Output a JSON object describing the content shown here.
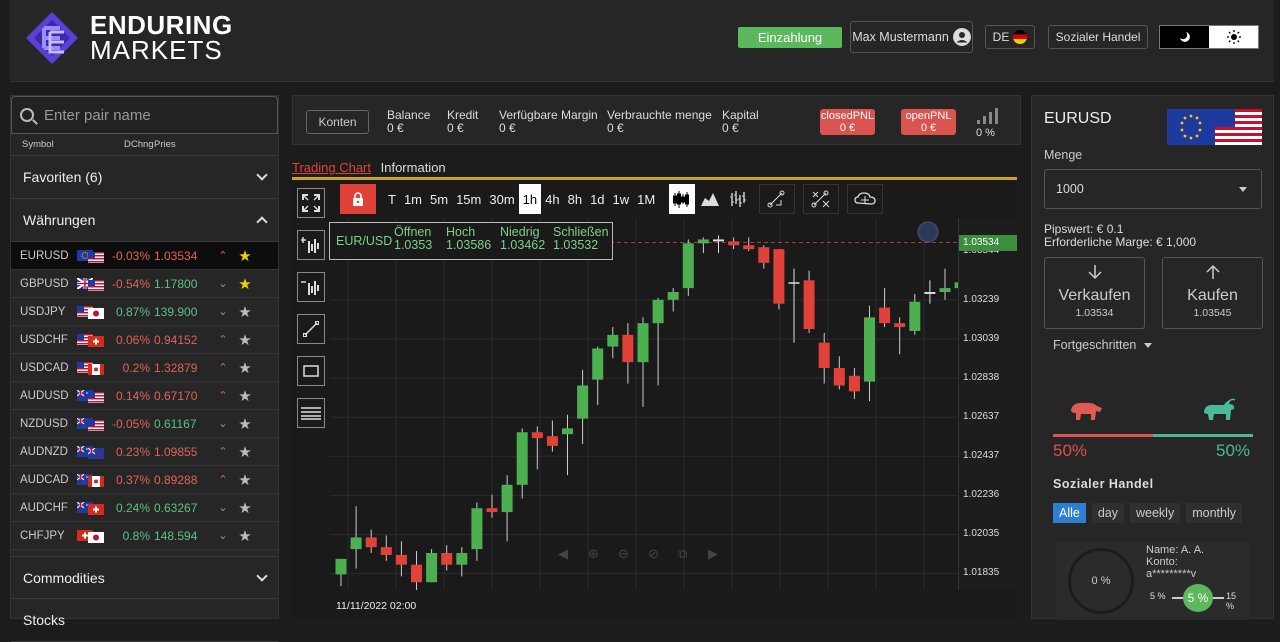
{
  "logo": {
    "line1": "ENDURING",
    "line2": "MARKETS"
  },
  "header": {
    "deposit_label": "Einzahlung",
    "user_name": "Max Mustermann",
    "language": "DE",
    "social_label": "Sozialer Handel",
    "theme_dark_icon": "moon-icon",
    "theme_light_icon": "sun-icon"
  },
  "watchlist": {
    "search_placeholder": "Enter pair name",
    "col_symbol": "Symbol",
    "col_change": "DChng",
    "col_price": "Pries",
    "favorites_label": "Favoriten (6)",
    "currencies_label": "Währungen",
    "commodities_label": "Commodities",
    "stocks_label": "Stocks",
    "pairs": [
      {
        "symbol": "EURUSD",
        "change": "-0.03%",
        "price": "1.03534",
        "dir": "up",
        "fav": true
      },
      {
        "symbol": "GBPUSD",
        "change": "-0.54%",
        "price": "1.17800",
        "dir": "down",
        "fav": true
      },
      {
        "symbol": "USDJPY",
        "change": "0.87%",
        "price": "139.900",
        "dir": "down",
        "fav": false
      },
      {
        "symbol": "USDCHF",
        "change": "0.06%",
        "price": "0.94152",
        "dir": "up",
        "fav": false
      },
      {
        "symbol": "USDCAD",
        "change": "0.2%",
        "price": "1.32879",
        "dir": "up",
        "fav": false
      },
      {
        "symbol": "AUDUSD",
        "change": "0.14%",
        "price": "0.67170",
        "dir": "up",
        "fav": false
      },
      {
        "symbol": "NZDUSD",
        "change": "-0.05%",
        "price": "0.61167",
        "dir": "down",
        "fav": false
      },
      {
        "symbol": "AUDNZD",
        "change": "0.23%",
        "price": "1.09855",
        "dir": "up",
        "fav": false
      },
      {
        "symbol": "AUDCAD",
        "change": "0.37%",
        "price": "0.89288",
        "dir": "up",
        "fav": false
      },
      {
        "symbol": "AUDCHF",
        "change": "0.24%",
        "price": "0.63267",
        "dir": "down",
        "fav": false
      },
      {
        "symbol": "CHFJPY",
        "change": "0.8%",
        "price": "148.594",
        "dir": "down",
        "fav": false
      }
    ]
  },
  "account": {
    "konten_label": "Konten",
    "balance_label": "Balance",
    "balance_value": "0 €",
    "kredit_label": "Kredit",
    "kredit_value": "0 €",
    "margin_label": "Verfügbare Margin",
    "margin_value": "0 €",
    "used_label": "Verbrauchte menge",
    "used_value": "0 €",
    "kapital_label": "Kapital",
    "kapital_value": "0 €",
    "closed_label": "closedPNL",
    "closed_value": "0 €",
    "open_label": "openPNL",
    "open_value": "0 €",
    "signal_pct": "0 %"
  },
  "chart_tabs": {
    "chart": "Trading Chart",
    "info": "Information"
  },
  "timeframes": [
    "T",
    "1m",
    "5m",
    "15m",
    "30m",
    "1h",
    "4h",
    "8h",
    "1d",
    "1w",
    "1M"
  ],
  "active_timeframe": "1h",
  "chart_legend": {
    "pair": "EUR/USD",
    "open_label": "Öffnen",
    "open": "1.0353",
    "high_label": "Hoch",
    "high": "1.03586",
    "low_label": "Niedrig",
    "low": "1.03462",
    "close_label": "Schließen",
    "close": "1.03532"
  },
  "chart_data": {
    "type": "candlestick",
    "y_ticks": [
      "1.03239",
      "1.03039",
      "1.02838",
      "1.02637",
      "1.02437",
      "1.02236",
      "1.02035",
      "1.01835"
    ],
    "current_price": "1.03534",
    "partial_tick": "1.03544",
    "x_label": "11/11/2022 02:00",
    "ylim": [
      1.0175,
      1.0366
    ],
    "colors": {
      "up": "#4caf50",
      "down": "#e0423a"
    },
    "candles": [
      [
        1.0183,
        1.0191,
        1.0177,
        1.0191
      ],
      [
        1.0196,
        1.0218,
        1.0186,
        1.0202
      ],
      [
        1.0202,
        1.0206,
        1.0194,
        1.0197
      ],
      [
        1.0197,
        1.0203,
        1.019,
        1.0193
      ],
      [
        1.0193,
        1.02,
        1.0182,
        1.0188
      ],
      [
        1.0188,
        1.0195,
        1.0172,
        1.0179
      ],
      [
        1.0179,
        1.0196,
        1.0179,
        1.0194
      ],
      [
        1.0194,
        1.0198,
        1.0185,
        1.0188
      ],
      [
        1.0188,
        1.0197,
        1.0182,
        1.0194
      ],
      [
        1.0196,
        1.022,
        1.019,
        1.0217
      ],
      [
        1.0217,
        1.0224,
        1.0212,
        1.0215
      ],
      [
        1.0215,
        1.0234,
        1.02,
        1.0229
      ],
      [
        1.0229,
        1.0258,
        1.0222,
        1.0256
      ],
      [
        1.0256,
        1.0259,
        1.0237,
        1.0253
      ],
      [
        1.0254,
        1.0262,
        1.0246,
        1.0249
      ],
      [
        1.0255,
        1.0265,
        1.0234,
        1.0258
      ],
      [
        1.0263,
        1.0288,
        1.025,
        1.028
      ],
      [
        1.0283,
        1.03,
        1.027,
        1.0299
      ],
      [
        1.03,
        1.031,
        1.0294,
        1.0306
      ],
      [
        1.0306,
        1.0312,
        1.0281,
        1.0292
      ],
      [
        1.0292,
        1.0315,
        1.0269,
        1.0312
      ],
      [
        1.0312,
        1.0325,
        1.028,
        1.0324
      ],
      [
        1.0324,
        1.033,
        1.0318,
        1.0328
      ],
      [
        1.033,
        1.0355,
        1.0326,
        1.0353
      ],
      [
        1.0353,
        1.0356,
        1.0348,
        1.0355
      ],
      [
        1.0355,
        1.0357,
        1.0348,
        1.0354
      ],
      [
        1.0354,
        1.0356,
        1.035,
        1.0352
      ],
      [
        1.0352,
        1.0356,
        1.0349,
        1.035
      ],
      [
        1.0351,
        1.0352,
        1.034,
        1.0343
      ],
      [
        1.035,
        1.035,
        1.0319,
        1.0322
      ],
      [
        1.0333,
        1.034,
        1.0302,
        1.0333
      ],
      [
        1.0334,
        1.0339,
        1.0307,
        1.0309
      ],
      [
        1.0302,
        1.0307,
        1.0281,
        1.0289
      ],
      [
        1.0289,
        1.0295,
        1.0278,
        1.028
      ],
      [
        1.0285,
        1.0289,
        1.0273,
        1.0277
      ],
      [
        1.0282,
        1.0321,
        1.0272,
        1.0315
      ],
      [
        1.032,
        1.033,
        1.031,
        1.0312
      ],
      [
        1.0312,
        1.0315,
        1.0296,
        1.031
      ],
      [
        1.0308,
        1.0327,
        1.0306,
        1.0323
      ],
      [
        1.0327,
        1.0334,
        1.0322,
        1.0328
      ],
      [
        1.0328,
        1.034,
        1.0324,
        1.033
      ],
      [
        1.033,
        1.0346,
        1.0325,
        1.0333
      ],
      [
        1.0334,
        1.0354,
        1.0329,
        1.0352
      ],
      [
        1.0352,
        1.0356,
        1.0346,
        1.0353
      ]
    ]
  },
  "order_panel": {
    "symbol": "EURUSD",
    "quantity_label": "Menge",
    "quantity_value": "1000",
    "pip_value": "Pipswert: € 0.1",
    "margin_req": "Erforderliche Marge: € 1,000",
    "sell_label": "Verkaufen",
    "sell_price": "1.03534",
    "buy_label": "Kaufen",
    "buy_price": "1.03545",
    "advanced_label": "Fortgeschritten",
    "sentiment_sell": 50,
    "sentiment_buy": 50,
    "sentiment_sell_label": "50%",
    "sentiment_buy_label": "50%",
    "social_title": "Sozialer Handel",
    "social_tabs": [
      "Alle",
      "day",
      "weekly",
      "monthly"
    ],
    "trader": {
      "ring_value": "0 %",
      "name": "Name: A. A.",
      "konto_label": "Konto:",
      "konto_value": "a*********v",
      "slider_min": "5 %",
      "slider_value": "5 %",
      "slider_max": "15 %"
    }
  }
}
